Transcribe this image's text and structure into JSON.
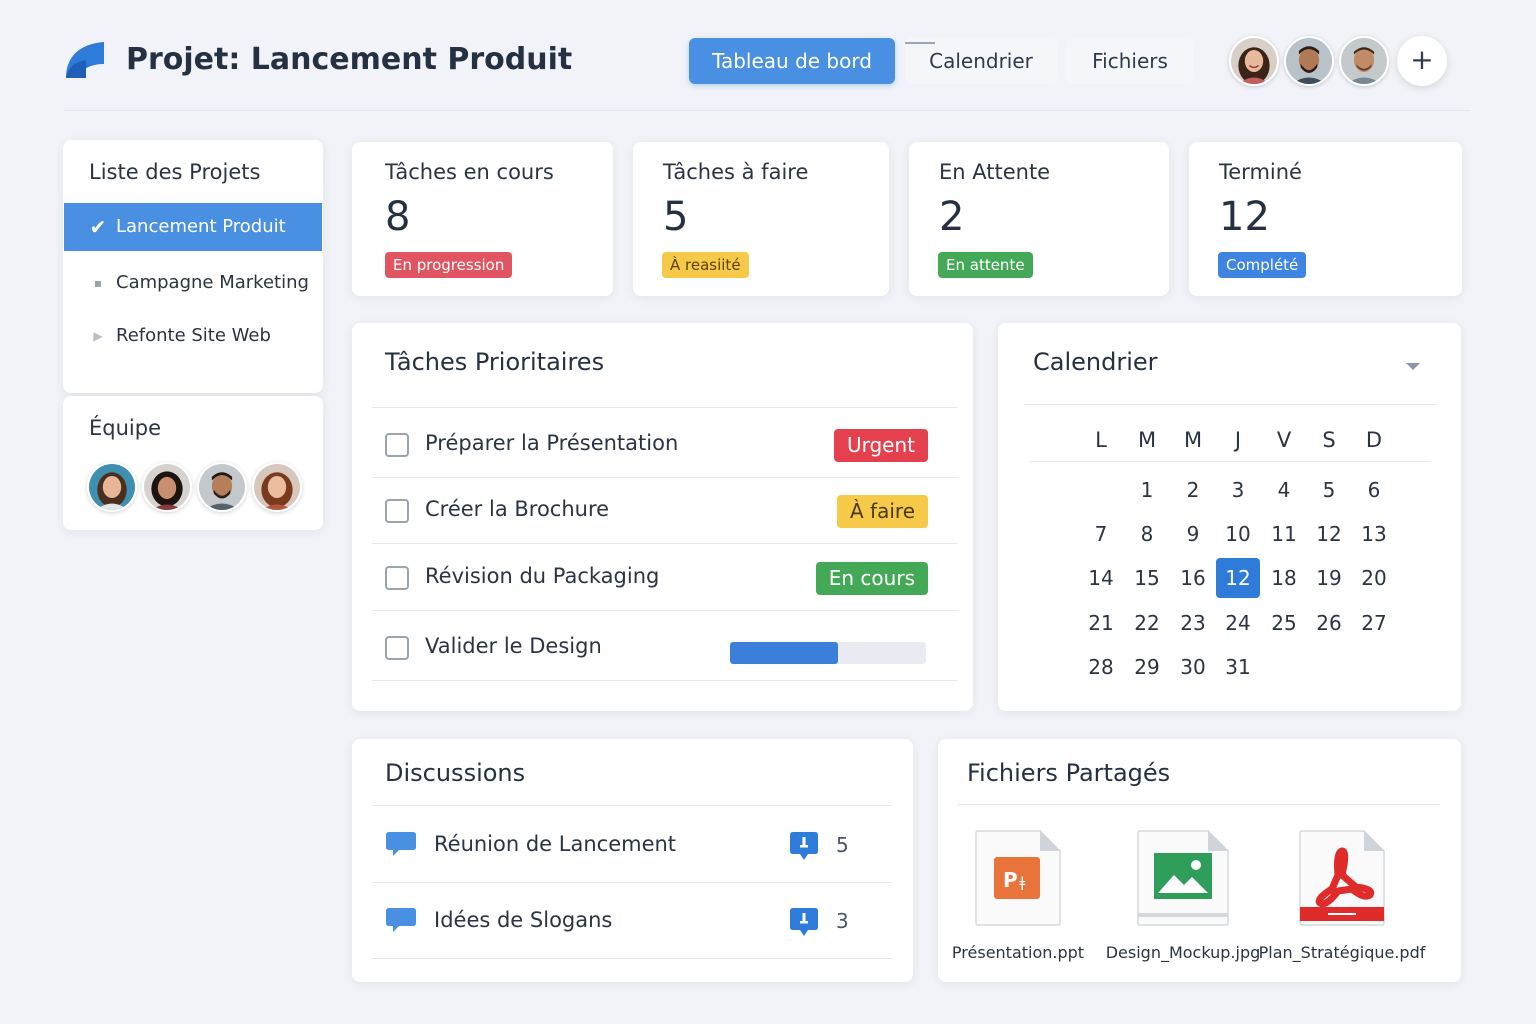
{
  "header": {
    "title": "Projet: Lancement Produit",
    "tabs": [
      {
        "label": "Tableau de bord",
        "active": true
      },
      {
        "label": "Calendrier",
        "active": false
      },
      {
        "label": "Fichiers",
        "active": false
      }
    ],
    "add_member_label": "+",
    "accent_color": "#4a90e2"
  },
  "sidebar": {
    "projects_heading": "Liste des Projets",
    "projects": [
      {
        "label": "Lancement Produit",
        "active": true,
        "icon": "check-icon"
      },
      {
        "label": "Campagne Marketing",
        "active": false,
        "icon": "bullet-icon"
      },
      {
        "label": "Refonte Site Web",
        "active": false,
        "icon": "triangle-right-icon"
      }
    ],
    "team_heading": "Équipe"
  },
  "stats": [
    {
      "title": "Tâches en cours",
      "value": "8",
      "badge": "En progression",
      "badge_bg": "#e05561",
      "badge_fg": "#ffffff"
    },
    {
      "title": "Tâches à faire",
      "value": "5",
      "badge": "À reasiité",
      "badge_bg": "#f7c948",
      "badge_fg": "#5a4500"
    },
    {
      "title": "En Attente",
      "value": "2",
      "badge": "En attente",
      "badge_bg": "#43a957",
      "badge_fg": "#ffffff"
    },
    {
      "title": "Terminé",
      "value": "12",
      "badge": "Complété",
      "badge_bg": "#3d85e0",
      "badge_fg": "#ffffff"
    }
  ],
  "priority_tasks": {
    "title": "Tâches Prioritaires",
    "tasks": [
      {
        "label": "Préparer la Présentation",
        "badge": "Urgent",
        "badge_bg": "#e5404e",
        "badge_fg": "#ffffff"
      },
      {
        "label": "Créer la Brochure",
        "badge": "À faire",
        "badge_bg": "#f7c948",
        "badge_fg": "#4a3a00"
      },
      {
        "label": "Révision du Packaging",
        "badge": "En cours",
        "badge_bg": "#43a957",
        "badge_fg": "#ffffff"
      },
      {
        "label": "Valider le Design",
        "progress": 0.55
      }
    ]
  },
  "calendar": {
    "title": "Calendrier",
    "weekdays": [
      "L",
      "M",
      "M",
      "J",
      "V",
      "S",
      "D"
    ],
    "first_day_column": 1,
    "days": [
      "1",
      "2",
      "3",
      "4",
      "5",
      "6",
      "7",
      "8",
      "9",
      "10",
      "11",
      "12",
      "13",
      "14",
      "15",
      "16",
      "12",
      "18",
      "19",
      "20",
      "21",
      "22",
      "23",
      "24",
      "25",
      "26",
      "27",
      "28",
      "29",
      "30",
      "31"
    ],
    "highlighted_index": 16
  },
  "discussions": {
    "title": "Discussions",
    "items": [
      {
        "label": "Réunion de Lancement",
        "count": "5"
      },
      {
        "label": "Idées de Slogans",
        "count": "3"
      }
    ]
  },
  "files": {
    "title": "Fichiers Partagés",
    "items": [
      {
        "name": "Présentation.ppt",
        "icon": "ppt-file-icon"
      },
      {
        "name": "Design_Mockup.jpg",
        "icon": "image-file-icon"
      },
      {
        "name": "Plan_Stratégique.pdf",
        "icon": "pdf-file-icon"
      }
    ]
  }
}
